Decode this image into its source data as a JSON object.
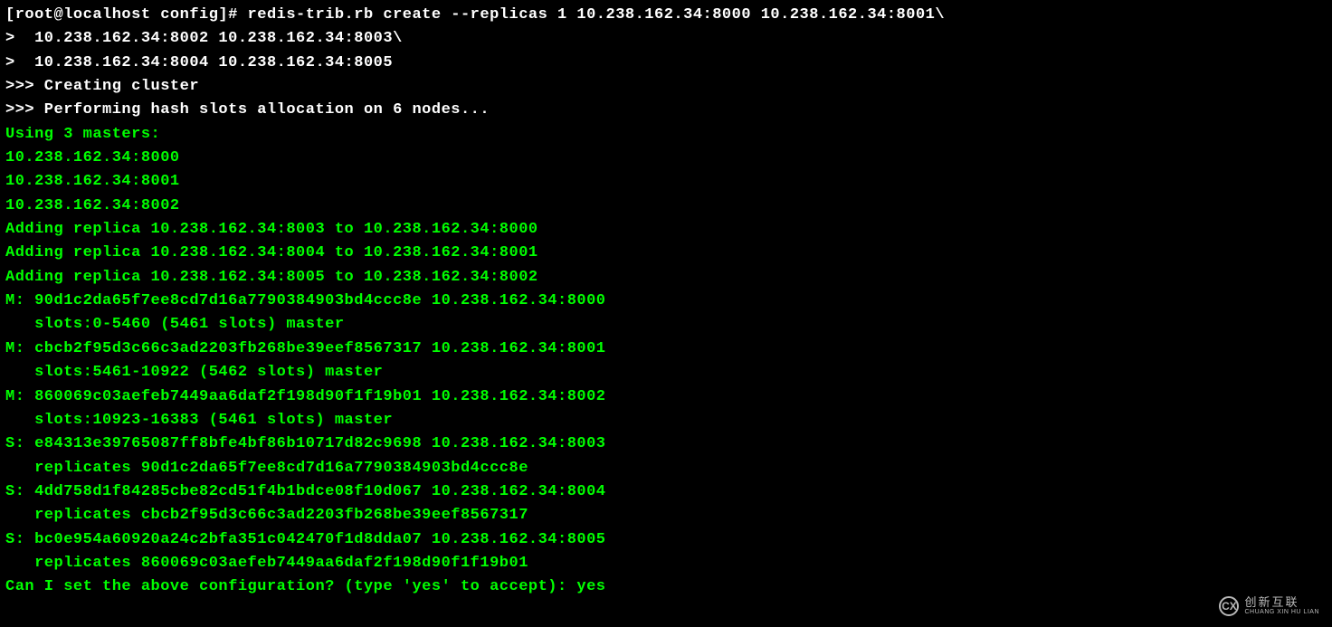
{
  "terminal": {
    "prompt_line1": "[root@localhost config]# redis-trib.rb create --replicas 1 10.238.162.34:8000 10.238.162.34:8001\\",
    "prompt_line2": ">  10.238.162.34:8002 10.238.162.34:8003\\",
    "prompt_line3": ">  10.238.162.34:8004 10.238.162.34:8005",
    "creating": ">>> Creating cluster",
    "performing": ">>> Performing hash slots allocation on 6 nodes...",
    "using_masters": "Using 3 masters:",
    "master1": "10.238.162.34:8000",
    "master2": "10.238.162.34:8001",
    "master3": "10.238.162.34:8002",
    "add_replica1": "Adding replica 10.238.162.34:8003 to 10.238.162.34:8000",
    "add_replica2": "Adding replica 10.238.162.34:8004 to 10.238.162.34:8001",
    "add_replica3": "Adding replica 10.238.162.34:8005 to 10.238.162.34:8002",
    "m1_line1": "M: 90d1c2da65f7ee8cd7d16a7790384903bd4ccc8e 10.238.162.34:8000",
    "m1_line2": "   slots:0-5460 (5461 slots) master",
    "m2_line1": "M: cbcb2f95d3c66c3ad2203fb268be39eef8567317 10.238.162.34:8001",
    "m2_line2": "   slots:5461-10922 (5462 slots) master",
    "m3_line1": "M: 860069c03aefeb7449aa6daf2f198d90f1f19b01 10.238.162.34:8002",
    "m3_line2": "   slots:10923-16383 (5461 slots) master",
    "s1_line1": "S: e84313e39765087ff8bfe4bf86b10717d82c9698 10.238.162.34:8003",
    "s1_line2": "   replicates 90d1c2da65f7ee8cd7d16a7790384903bd4ccc8e",
    "s2_line1": "S: 4dd758d1f84285cbe82cd51f4b1bdce08f10d067 10.238.162.34:8004",
    "s2_line2": "   replicates cbcb2f95d3c66c3ad2203fb268be39eef8567317",
    "s3_line1": "S: bc0e954a60920a24c2bfa351c042470f1d8dda07 10.238.162.34:8005",
    "s3_line2": "   replicates 860069c03aefeb7449aa6daf2f198d90f1f19b01",
    "confirm": "Can I set the above configuration? (type 'yes' to accept): yes"
  },
  "watermark": {
    "icon": "CX",
    "top": "创新互联",
    "bottom": "CHUANG XIN HU LIAN"
  }
}
